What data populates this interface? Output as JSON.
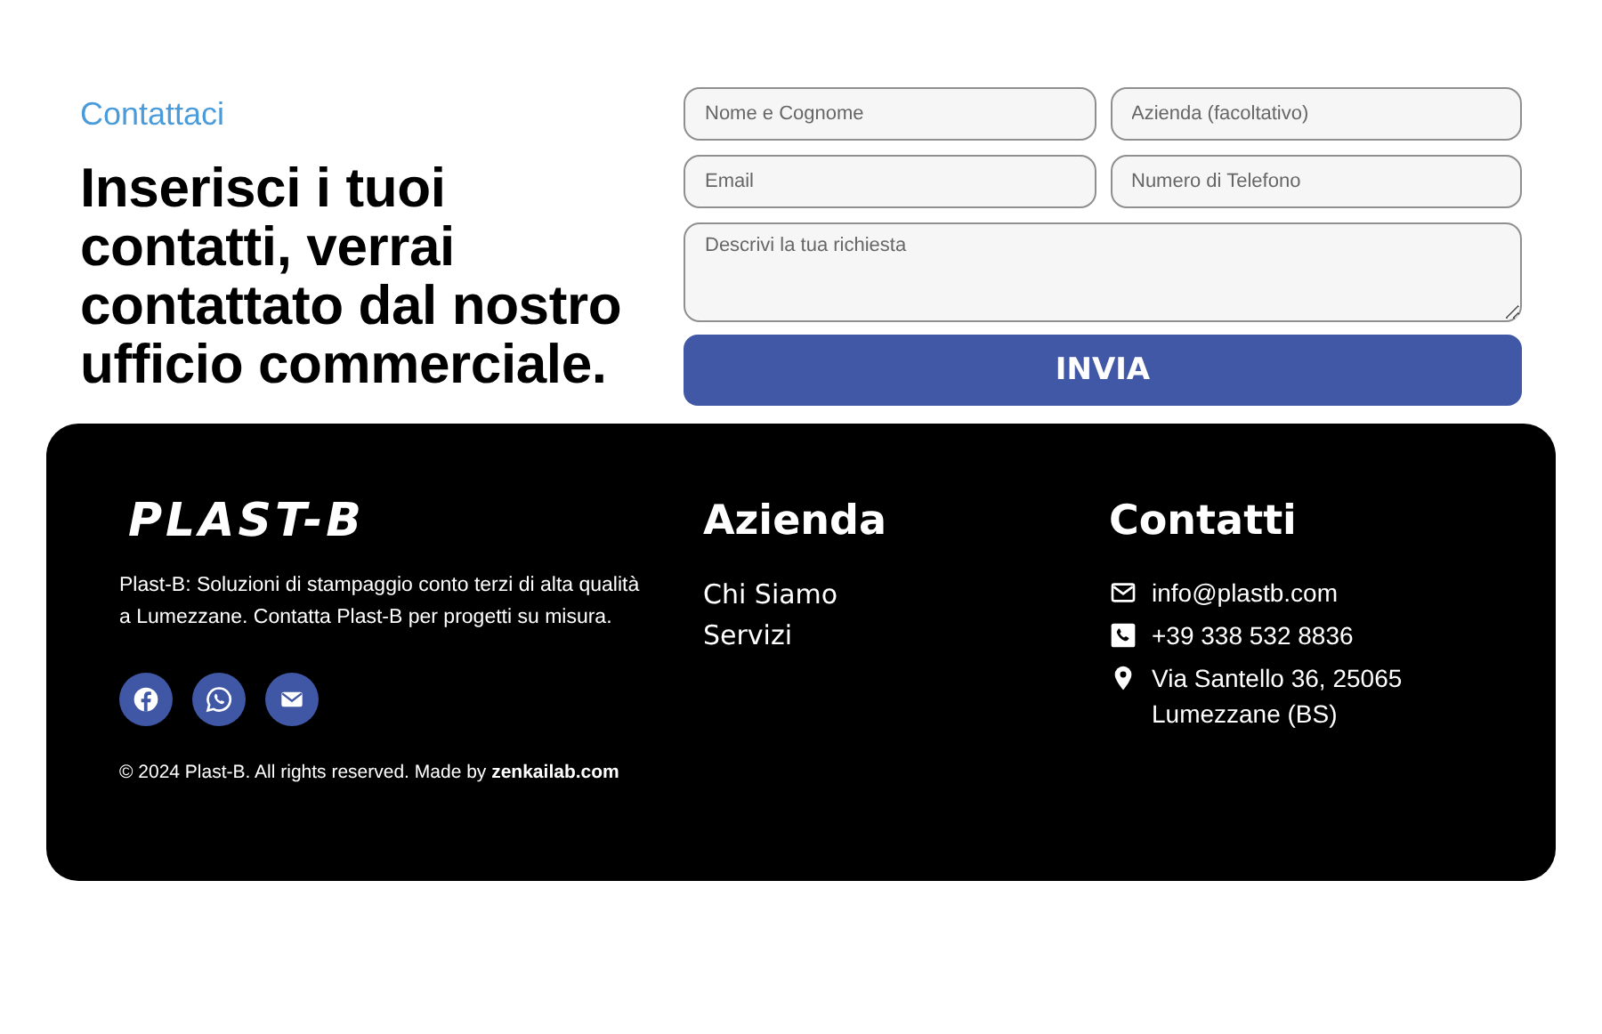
{
  "contact": {
    "eyebrow": "Contattaci",
    "heading": "Inserisci i tuoi contatti, verrai contattato dal nostro ufficio commerciale."
  },
  "form": {
    "fields": [
      {
        "kind": "input",
        "placeholder": "Nome e Cognome"
      },
      {
        "kind": "input",
        "placeholder": "Azienda (facoltativo)"
      },
      {
        "kind": "input",
        "placeholder": "Email"
      },
      {
        "kind": "input",
        "placeholder": "Numero di Telefono"
      },
      {
        "kind": "textarea",
        "placeholder": "Descrivi la tua richiesta"
      }
    ],
    "submit": "INVIA"
  },
  "footer": {
    "logo": "PLAST-B",
    "description": "Plast-B: Soluzioni di stampaggio conto terzi di alta qualità a Lumezzane. Contatta Plast-B per progetti su misura.",
    "social": [
      {
        "kind": "facebook"
      },
      {
        "kind": "whatsapp"
      },
      {
        "kind": "email"
      }
    ],
    "copyright": "© 2024 Plast-B. All rights reserved. Made by",
    "credit_link": "zenkailab.com",
    "company": {
      "title": "Azienda",
      "links": [
        "Chi Siamo",
        "Servizi"
      ]
    },
    "contacts": {
      "title": "Contatti",
      "items": [
        {
          "kind": "email",
          "text": "info@plastb.com"
        },
        {
          "kind": "phone",
          "text": "+39 338 532 8836"
        },
        {
          "kind": "address",
          "text": "Via Santello 36, 25065 Lumezzane (BS)"
        }
      ]
    }
  }
}
